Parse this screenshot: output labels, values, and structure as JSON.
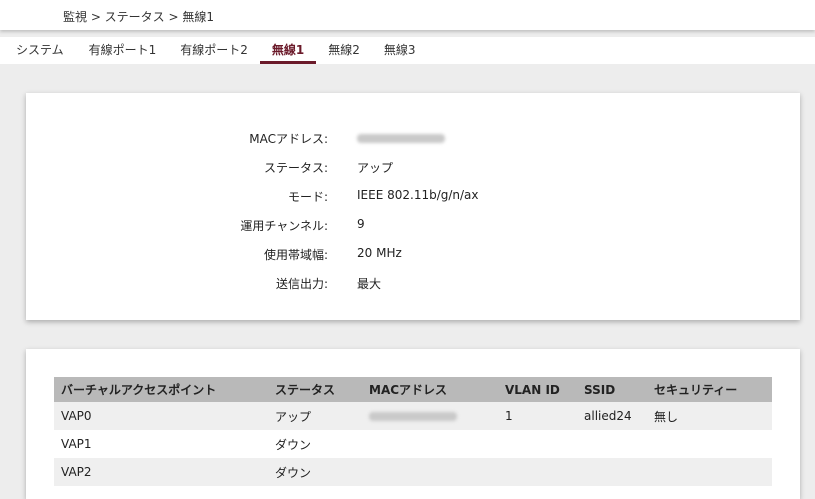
{
  "breadcrumb": "監視 > ステータス > 無線1",
  "tabs": [
    {
      "label": "システム"
    },
    {
      "label": "有線ポート1"
    },
    {
      "label": "有線ポート2"
    },
    {
      "label": "無線1",
      "active": true
    },
    {
      "label": "無線2"
    },
    {
      "label": "無線3"
    }
  ],
  "radio_info": {
    "mac_label": "MACアドレス:",
    "mac_value": "",
    "status_label": "ステータス:",
    "status_value": "アップ",
    "mode_label": "モード:",
    "mode_value": "IEEE 802.11b/g/n/ax",
    "channel_label": "運用チャンネル:",
    "channel_value": "9",
    "bandwidth_label": "使用帯域幅:",
    "bandwidth_value": "20 MHz",
    "power_label": "送信出力:",
    "power_value": "最大"
  },
  "vap_table": {
    "headers": [
      "バーチャルアクセスポイント",
      "ステータス",
      "MACアドレス",
      "VLAN ID",
      "SSID",
      "セキュリティー"
    ],
    "rows": [
      [
        "VAP0",
        "アップ",
        "",
        "1",
        "allied24",
        "無し"
      ],
      [
        "VAP1",
        "ダウン",
        "",
        "",
        "",
        ""
      ],
      [
        "VAP2",
        "ダウン",
        "",
        "",
        "",
        ""
      ]
    ]
  },
  "colors": {
    "accent": "#6b1a2a",
    "table_header": "#b9b9b9",
    "page_background": "#ededed"
  }
}
